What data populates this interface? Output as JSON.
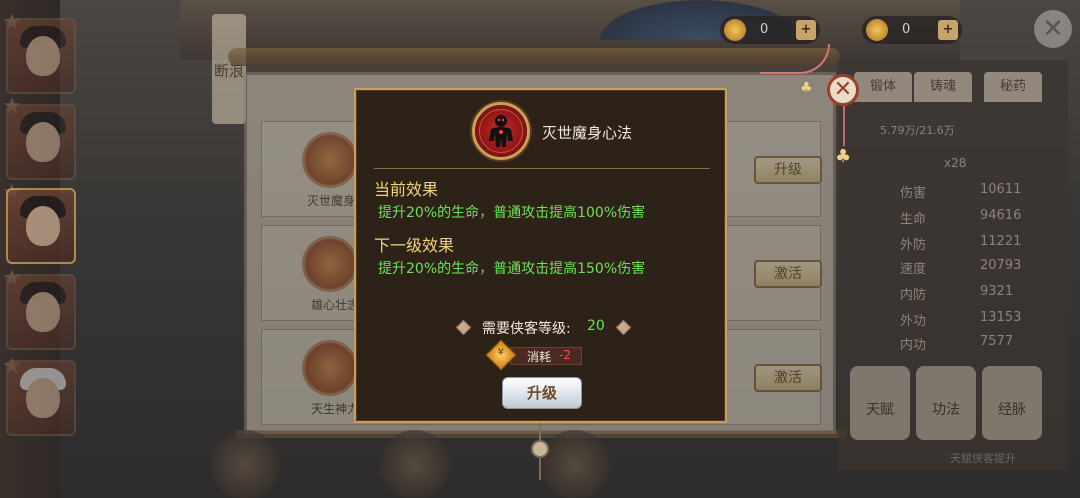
{
  "dialog": {
    "skill_name": "灭世魔身心法",
    "current_effect_title": "当前效果",
    "current_effect_text": "提升20%的生命，普通攻击提高100%伤害",
    "next_effect_title": "下一级效果",
    "next_effect_text": "提升20%的生命，普通攻击提高150%伤害",
    "requirement_label": "需要侠客等级:",
    "requirement_value": "20",
    "cost_label": "消耗",
    "cost_value": "-2",
    "upgrade_label": "升级"
  },
  "background": {
    "top_currency": [
      {
        "value": "0"
      },
      {
        "value": "0"
      }
    ],
    "scroll_label": "断浪",
    "skills": [
      {
        "name": "灭世魔身心",
        "button": "升级"
      },
      {
        "name": "雄心壮志·",
        "button": "激活"
      },
      {
        "name": "天生神力·",
        "button": "激活"
      }
    ],
    "tabs": [
      "锻体",
      "铸魂",
      "秘药"
    ],
    "progress_text": "5.79万/21.6万",
    "multiplier": "x28",
    "stats": [
      {
        "label": "伤害",
        "value": "10611"
      },
      {
        "label": "生命",
        "value": "94616"
      },
      {
        "label": "外防",
        "value": "11221"
      },
      {
        "label": "速度",
        "value": "20793"
      },
      {
        "label": "内防",
        "value": "9321"
      },
      {
        "label": "外功",
        "value": "13153"
      },
      {
        "label": "内功",
        "value": "7577"
      }
    ],
    "bottom_buttons": [
      "天赋",
      "功法",
      "经脉"
    ],
    "hint_text": "天赋侠客提升"
  },
  "colors": {
    "dialog_border": "#c8a05a",
    "effect_green": "#6fe05a",
    "heading_gold": "#f2d27a",
    "cost_red": "#ff4a4a"
  }
}
